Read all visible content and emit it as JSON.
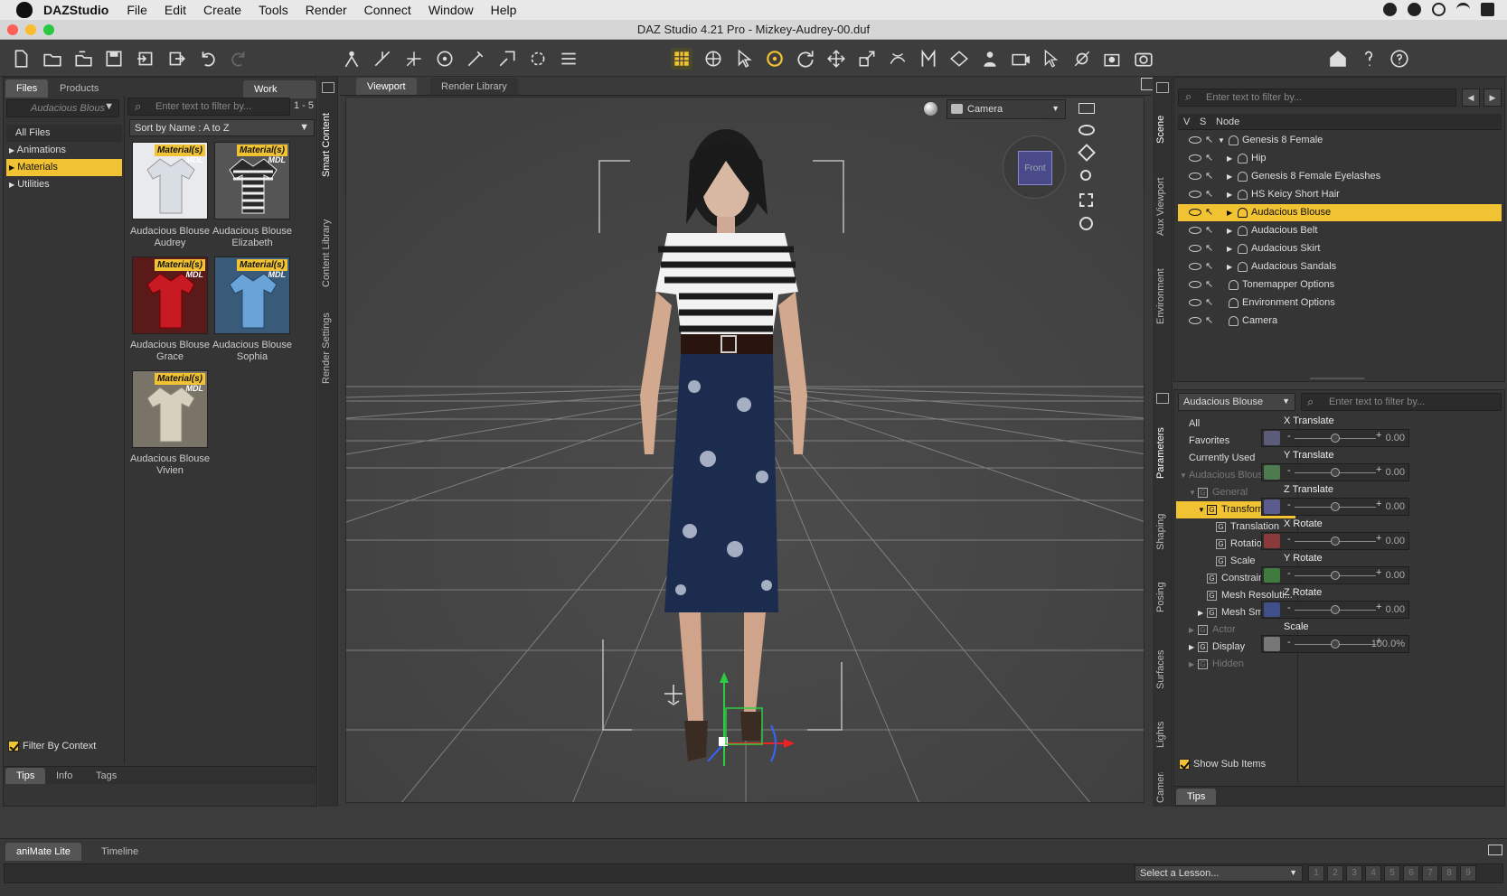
{
  "menubar": {
    "app_name": "DAZStudio",
    "items": [
      "File",
      "Edit",
      "Create",
      "Tools",
      "Render",
      "Connect",
      "Window",
      "Help"
    ]
  },
  "window": {
    "title": "DAZ Studio 4.21 Pro - Mizkey-Audrey-00.duf"
  },
  "left_panel": {
    "tabs": [
      "Files",
      "Products"
    ],
    "work_offline": "Work Offline",
    "category_select": "Audacious Blous",
    "filter_placeholder": "Enter text to filter by...",
    "count": "1 - 5",
    "sort": "Sort by Name : A to Z",
    "tree": [
      {
        "label": "All Files",
        "selected": false
      },
      {
        "label": "Animations",
        "selected": false,
        "expander": "▶"
      },
      {
        "label": "Materials",
        "selected": true,
        "expander": "▶"
      },
      {
        "label": "Utilities",
        "selected": false,
        "expander": "▶"
      }
    ],
    "assets": [
      {
        "name": "Audacious Blouse Audrey",
        "badge": "Material(s)",
        "mdl": "MDL",
        "color": "#d9dde4"
      },
      {
        "name": "Audacious Blouse Elizabeth",
        "badge": "Material(s)",
        "mdl": "MDL",
        "color": "#2a2a2a"
      },
      {
        "name": "Audacious Blouse Grace",
        "badge": "Material(s)",
        "mdl": "MDL",
        "color": "#c81a22"
      },
      {
        "name": "Audacious Blouse Sophia",
        "badge": "Material(s)",
        "mdl": "MDL",
        "color": "#6aa3d8"
      },
      {
        "name": "Audacious Blouse Vivien",
        "badge": "Material(s)",
        "mdl": "MDL",
        "color": "#d8d0bf"
      }
    ],
    "filter_by_context": "Filter By Context",
    "bottom_tabs": [
      "Tips",
      "Info",
      "Tags"
    ],
    "side_tabs": [
      "Smart Content",
      "Content Library",
      "Render Settings"
    ]
  },
  "viewport": {
    "tabs": [
      "Viewport",
      "Render Library"
    ],
    "camera": "Camera",
    "cube_label": "Front"
  },
  "scene": {
    "filter_placeholder": "Enter text to filter by...",
    "columns": [
      "V",
      "S",
      "Node"
    ],
    "nodes": [
      {
        "label": "Genesis 8 Female",
        "indent": 0,
        "expander": "▼",
        "selected": false
      },
      {
        "label": "Hip",
        "indent": 1,
        "expander": "▶",
        "selected": false
      },
      {
        "label": "Genesis 8 Female Eyelashes",
        "indent": 1,
        "expander": "▶",
        "selected": false
      },
      {
        "label": "HS Keicy Short Hair",
        "indent": 1,
        "expander": "▶",
        "selected": false
      },
      {
        "label": "Audacious Blouse",
        "indent": 1,
        "expander": "▶",
        "selected": true
      },
      {
        "label": "Audacious Belt",
        "indent": 1,
        "expander": "▶",
        "selected": false
      },
      {
        "label": "Audacious Skirt",
        "indent": 1,
        "expander": "▶",
        "selected": false
      },
      {
        "label": "Audacious Sandals",
        "indent": 1,
        "expander": "▶",
        "selected": false
      },
      {
        "label": "Tonemapper Options",
        "indent": 0,
        "expander": "",
        "selected": false
      },
      {
        "label": "Environment Options",
        "indent": 0,
        "expander": "",
        "selected": false
      },
      {
        "label": "Camera",
        "indent": 0,
        "expander": "",
        "selected": false
      }
    ],
    "side_tabs": [
      "Scene",
      "Aux Viewport",
      "Environment"
    ]
  },
  "parameters": {
    "node_select": "Audacious Blouse",
    "filter_placeholder": "Enter text to filter by...",
    "groups": [
      {
        "label": "All",
        "indent": 0,
        "expander": "",
        "selected": false,
        "dim": false,
        "box": false
      },
      {
        "label": "Favorites",
        "indent": 0,
        "expander": "",
        "selected": false,
        "dim": false,
        "box": false
      },
      {
        "label": "Currently Used",
        "indent": 0,
        "expander": "",
        "selected": false,
        "dim": false,
        "box": false
      },
      {
        "label": "Audacious Blouse",
        "indent": 0,
        "expander": "▼",
        "selected": false,
        "dim": true,
        "box": false
      },
      {
        "label": "General",
        "indent": 1,
        "expander": "▼",
        "selected": false,
        "dim": true,
        "box": true
      },
      {
        "label": "Transforms",
        "indent": 2,
        "expander": "▼",
        "selected": true,
        "dim": false,
        "box": true
      },
      {
        "label": "Translation",
        "indent": 3,
        "expander": "",
        "selected": false,
        "dim": false,
        "box": true
      },
      {
        "label": "Rotation",
        "indent": 3,
        "expander": "",
        "selected": false,
        "dim": false,
        "box": true
      },
      {
        "label": "Scale",
        "indent": 3,
        "expander": "",
        "selected": false,
        "dim": false,
        "box": true
      },
      {
        "label": "Constraints",
        "indent": 2,
        "expander": "",
        "selected": false,
        "dim": false,
        "box": true
      },
      {
        "label": "Mesh Resoluti...",
        "indent": 2,
        "expander": "",
        "selected": false,
        "dim": false,
        "box": true
      },
      {
        "label": "Mesh Smooth...",
        "indent": 2,
        "expander": "▶",
        "selected": false,
        "dim": false,
        "box": true
      },
      {
        "label": "Actor",
        "indent": 1,
        "expander": "▶",
        "selected": false,
        "dim": true,
        "box": true
      },
      {
        "label": "Display",
        "indent": 1,
        "expander": "▶",
        "selected": false,
        "dim": false,
        "box": true
      },
      {
        "label": "Hidden",
        "indent": 1,
        "expander": "▶",
        "selected": false,
        "dim": true,
        "box": true
      }
    ],
    "properties": [
      {
        "label": "X Translate",
        "value": "0.00",
        "icon_color": "#5b5b7a"
      },
      {
        "label": "Y Translate",
        "value": "0.00",
        "icon_color": "#4f7a4f"
      },
      {
        "label": "Z Translate",
        "value": "0.00",
        "icon_color": "#5b5b8f"
      },
      {
        "label": "X Rotate",
        "value": "0.00",
        "icon_color": "#8a3a3a"
      },
      {
        "label": "Y Rotate",
        "value": "0.00",
        "icon_color": "#3f7a3f"
      },
      {
        "label": "Z Rotate",
        "value": "0.00",
        "icon_color": "#3f4f8a"
      },
      {
        "label": "Scale",
        "value": "100.0%",
        "icon_color": "#777777"
      }
    ],
    "show_sub_items": "Show Sub Items",
    "bottom_tab": "Tips",
    "side_tabs": [
      "Parameters",
      "Shaping",
      "Posing",
      "Surfaces",
      "Lights",
      "Cameras"
    ]
  },
  "bottom": {
    "tabs": [
      "aniMate Lite",
      "Timeline"
    ],
    "lesson_select": "Select a Lesson...",
    "pages": [
      "1",
      "2",
      "3",
      "4",
      "5",
      "6",
      "7",
      "8",
      "9"
    ]
  }
}
